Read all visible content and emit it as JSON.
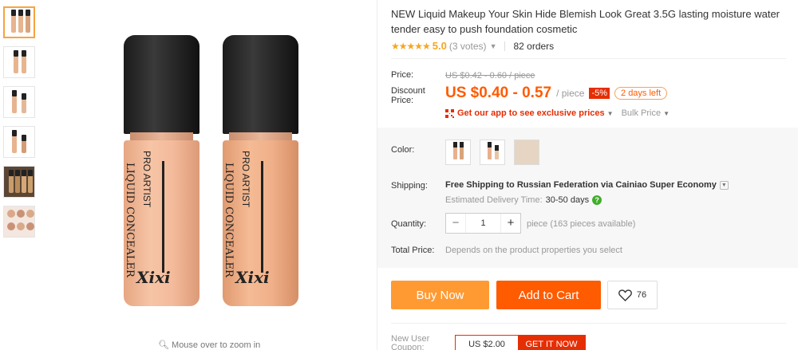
{
  "product": {
    "title": "NEW Liquid Makeup Your Skin Hide Blemish Look Great 3.5G lasting moisture water tender easy to push foundation cosmetic",
    "image_label_line1": "PRO ARTIST",
    "image_label_line2": "LIQUID CONCEALER",
    "image_brand": "Xixi",
    "zoom_hint": "Mouse over to zoom in"
  },
  "rating": {
    "stars": "★★★★★",
    "score": "5.0",
    "votes": "(3 votes)",
    "orders": "82 orders"
  },
  "price": {
    "label": "Price:",
    "old": "US $0.42 - 0.60 / piece",
    "discount_label_1": "Discount",
    "discount_label_2": "Price:",
    "current": "US $0.40 - 0.57",
    "per": "/ piece",
    "discount_badge": "-5%",
    "days_left": "2 days left",
    "app_link": "Get our app to see exclusive prices",
    "bulk": "Bulk Price"
  },
  "color": {
    "label": "Color:"
  },
  "shipping": {
    "label": "Shipping:",
    "free": "Free Shipping to",
    "destination": "Russian Federation via Cainiao Super Economy",
    "est_label": "Estimated Delivery Time:",
    "est_days": "30-50 days"
  },
  "quantity": {
    "label": "Quantity:",
    "value": "1",
    "minus": "−",
    "plus": "+",
    "available": "piece (163 pieces available)"
  },
  "total": {
    "label": "Total Price:",
    "text": "Depends on the product properties you select"
  },
  "actions": {
    "buy_now": "Buy Now",
    "add_to_cart": "Add to Cart",
    "wishlist_count": "76"
  },
  "coupon": {
    "label_1": "New User",
    "label_2": "Coupon:",
    "amount": "US $2.00",
    "get": "GET IT NOW"
  },
  "colors": {
    "accent": "#ff5b00",
    "buy": "#ff9a33",
    "star": "#f5a623",
    "red": "#e62e04",
    "green": "#3fae29"
  }
}
